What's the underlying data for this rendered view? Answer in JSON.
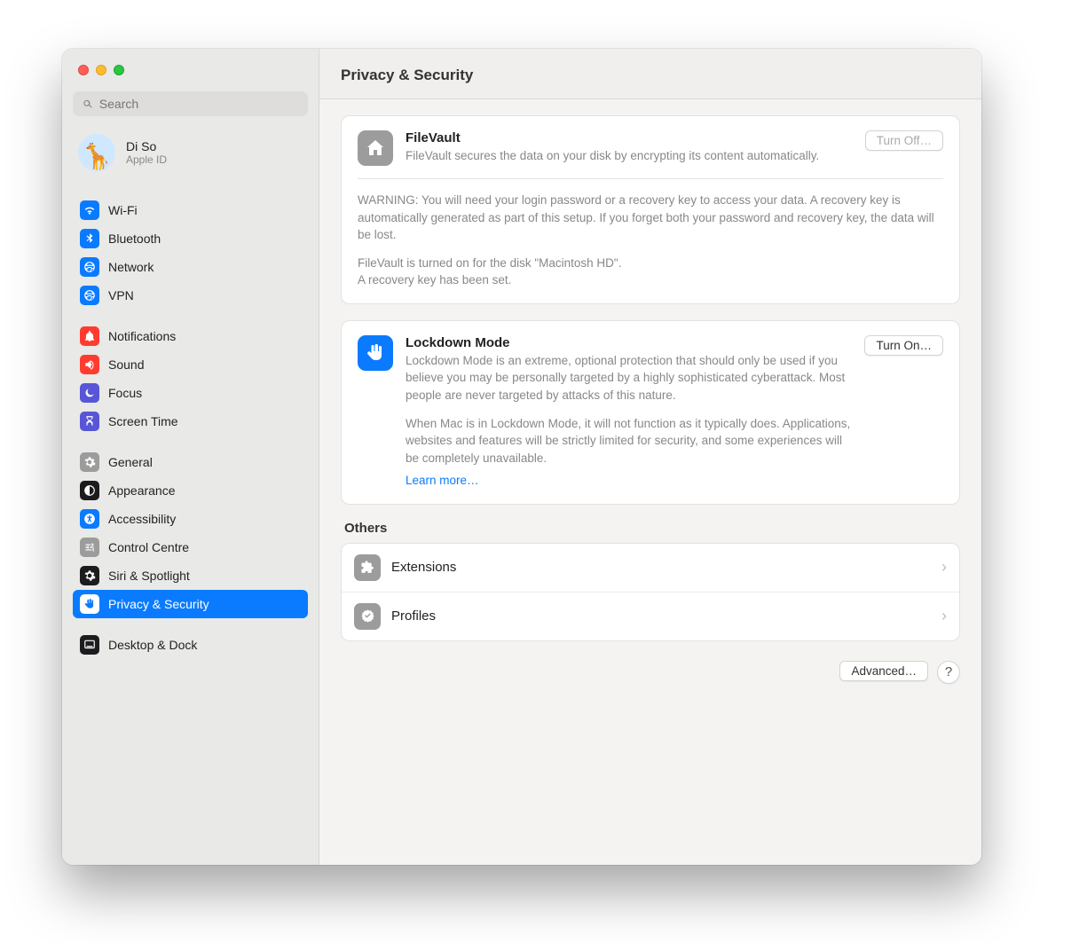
{
  "header": {
    "title": "Privacy & Security"
  },
  "search": {
    "placeholder": "Search"
  },
  "account": {
    "name": "Di So",
    "subtitle": "Apple ID"
  },
  "sidebar": {
    "groups": [
      {
        "items": [
          {
            "label": "Wi-Fi",
            "icon": "wifi",
            "color": "#0a7bff"
          },
          {
            "label": "Bluetooth",
            "icon": "bluetooth",
            "color": "#0a7bff"
          },
          {
            "label": "Network",
            "icon": "network",
            "color": "#0a7bff"
          },
          {
            "label": "VPN",
            "icon": "vpn",
            "color": "#0a7bff"
          }
        ]
      },
      {
        "items": [
          {
            "label": "Notifications",
            "icon": "bell",
            "color": "#ff3b30"
          },
          {
            "label": "Sound",
            "icon": "sound",
            "color": "#ff3b30"
          },
          {
            "label": "Focus",
            "icon": "moon",
            "color": "#5856d6"
          },
          {
            "label": "Screen Time",
            "icon": "hourglass",
            "color": "#5856d6"
          }
        ]
      },
      {
        "items": [
          {
            "label": "General",
            "icon": "gear",
            "color": "#9c9c9c"
          },
          {
            "label": "Appearance",
            "icon": "appearance",
            "color": "#1c1c1e"
          },
          {
            "label": "Accessibility",
            "icon": "access",
            "color": "#0a7bff"
          },
          {
            "label": "Control Centre",
            "icon": "sliders",
            "color": "#9c9c9c"
          },
          {
            "label": "Siri & Spotlight",
            "icon": "siri",
            "color": "#1c1c1e"
          },
          {
            "label": "Privacy & Security",
            "icon": "hand",
            "color": "#0a7bff",
            "selected": true
          }
        ]
      },
      {
        "items": [
          {
            "label": "Desktop & Dock",
            "icon": "dock",
            "color": "#1c1c1e"
          }
        ]
      }
    ]
  },
  "filevault": {
    "title": "FileVault",
    "desc": "FileVault secures the data on your disk by encrypting its content automatically.",
    "button": "Turn Off…",
    "warning": "WARNING: You will need your login password or a recovery key to access your data. A recovery key is automatically generated as part of this setup. If you forget both your password and recovery key, the data will be lost.",
    "status1": "FileVault is turned on for the disk \"Macintosh HD\".",
    "status2": "A recovery key has been set."
  },
  "lockdown": {
    "title": "Lockdown Mode",
    "desc1": "Lockdown Mode is an extreme, optional protection that should only be used if you believe you may be personally targeted by a highly sophisticated cyberattack. Most people are never targeted by attacks of this nature.",
    "desc2": "When Mac is in Lockdown Mode, it will not function as it typically does. Applications, websites and features will be strictly limited for security, and some experiences will be completely unavailable.",
    "learn": "Learn more…",
    "button": "Turn On…"
  },
  "others": {
    "label": "Others",
    "extensions": "Extensions",
    "profiles": "Profiles"
  },
  "footer": {
    "advanced": "Advanced…"
  }
}
